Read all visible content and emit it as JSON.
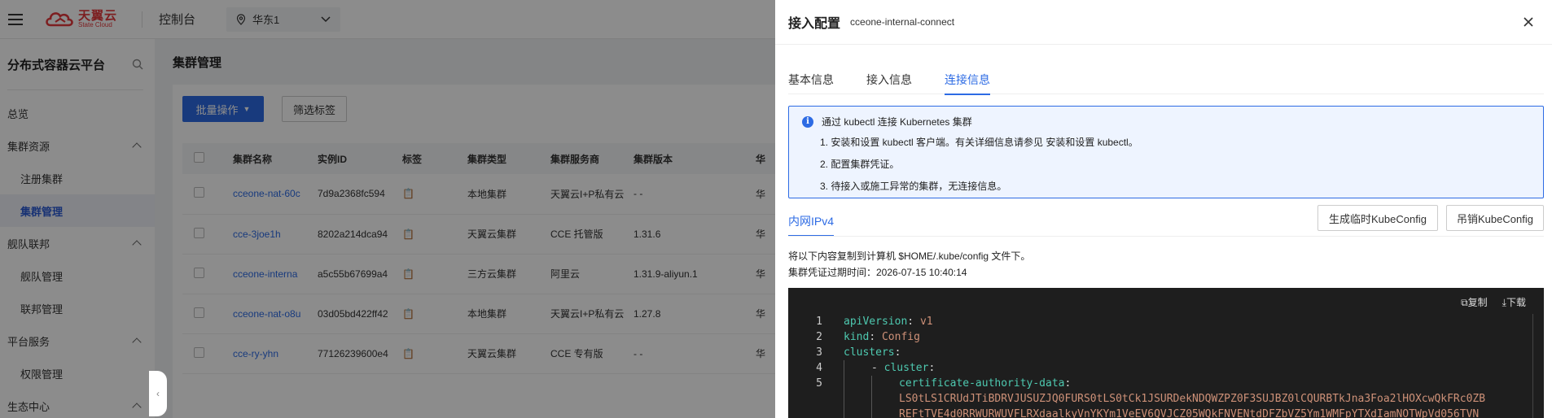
{
  "topbar": {
    "logo_cn": "天翼云",
    "logo_en": "State Cloud",
    "console": "控制台",
    "region": "华东1"
  },
  "sidebar": {
    "title": "分布式容器云平台",
    "items": [
      {
        "label": "总览",
        "level": 0
      },
      {
        "label": "集群资源",
        "level": 0,
        "expandable": true
      },
      {
        "label": "注册集群",
        "level": 1
      },
      {
        "label": "集群管理",
        "level": 1,
        "active": true
      },
      {
        "label": "舰队联邦",
        "level": 0,
        "expandable": true
      },
      {
        "label": "舰队管理",
        "level": 1
      },
      {
        "label": "联邦管理",
        "level": 1
      },
      {
        "label": "平台服务",
        "level": 0,
        "expandable": true
      },
      {
        "label": "权限管理",
        "level": 1
      },
      {
        "label": "生态中心",
        "level": 0,
        "expandable": true
      }
    ]
  },
  "main": {
    "page_title": "集群管理",
    "batch_button": "批量操作",
    "filter_button": "筛选标签",
    "columns": [
      "集群名称",
      "实例ID",
      "标签",
      "集群类型",
      "集群服务商",
      "集群版本",
      "华"
    ],
    "rows": [
      {
        "name": "cceone-nat-60c",
        "id": "7d9a2368fc594",
        "type": "本地集群",
        "vendor": "天翼云I+P私有云",
        "version": "- -",
        "region": "华"
      },
      {
        "name": "cce-3joe1h",
        "id": "8202a214dca94",
        "type": "天翼云集群",
        "vendor": "CCE 托管版",
        "version": "1.31.6",
        "region": "华"
      },
      {
        "name": "cceone-interna",
        "id": "a5c55b67699a4",
        "type": "三方云集群",
        "vendor": "阿里云",
        "version": "1.31.9-aliyun.1",
        "region": "华"
      },
      {
        "name": "cceone-nat-o8u",
        "id": "03d05bd422ff42",
        "type": "本地集群",
        "vendor": "天翼云I+P私有云",
        "version": "1.27.8",
        "region": "华"
      },
      {
        "name": "cce-ry-yhn",
        "id": "77126239600e4",
        "type": "天翼云集群",
        "vendor": "CCE 专有版",
        "version": "- -",
        "region": "华"
      }
    ]
  },
  "drawer": {
    "title": "接入配置",
    "subtitle": "cceone-internal-connect",
    "tabs": [
      "基本信息",
      "接入信息",
      "连接信息"
    ],
    "active_tab": 2,
    "info": {
      "heading": "通过 kubectl 连接 Kubernetes 集群",
      "lines": [
        "1. 安装和设置 kubectl 客户端。有关详细信息请参见 安装和设置 kubectl。",
        "2. 配置集群凭证。",
        "3. 待接入或施工异常的集群，无连接信息。"
      ]
    },
    "subtab": "内网IPv4",
    "btn_generate": "生成临时KubeConfig",
    "btn_revoke": "吊销KubeConfig",
    "desc1": "将以下内容复制到计算机 $HOME/.kube/config 文件下。",
    "desc2": "集群凭证过期时间：2026-07-15 10:40:14",
    "copy_label": "复制",
    "download_label": "下载",
    "code": [
      {
        "n": "1",
        "key": "apiVersion",
        "val": "v1"
      },
      {
        "n": "2",
        "key": "kind",
        "val": "Config"
      },
      {
        "n": "3",
        "key": "clusters",
        "val": ""
      },
      {
        "n": "4",
        "key": "cluster",
        "val": ""
      },
      {
        "n": "5",
        "key": "certificate-authority-data",
        "val": ""
      }
    ],
    "cert_line_1": "LS0tLS1CRUdJTiBDRVJUSUZJQ0FURS0tLS0tCk1JSURDekNDQWZPZ0F3SUJBZ0lCQURBTkJna3Foa2lHOXcwQkFRc0ZB",
    "cert_line_2": "REFtTVE4d0RRWURWUVFLRXdaalkyVnYKYm1VeEV6QVJCZ05WQkFNVENtdDFZbVZ5Ym1WMFpYTXdIamNOTWpVd056TVN"
  }
}
